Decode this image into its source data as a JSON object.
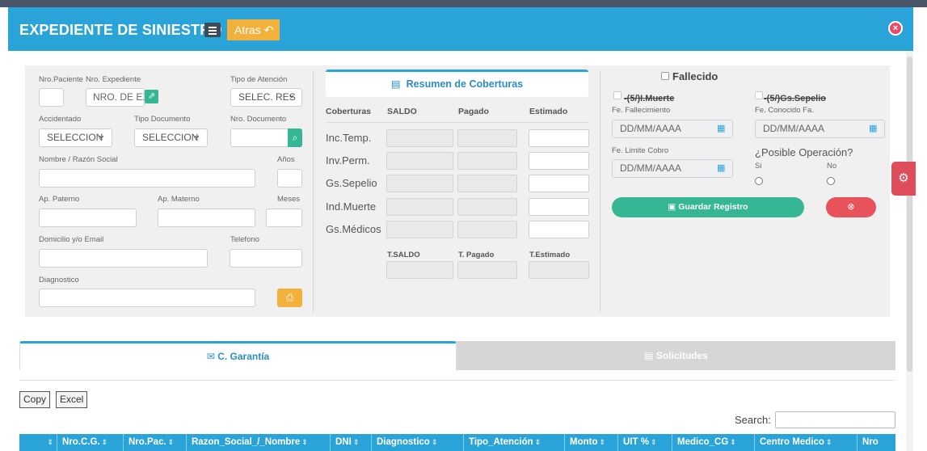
{
  "header": {
    "title": "EXPEDIENTE DE SINIESTRO",
    "back_label": "Atras",
    "back_icon": "↶",
    "close_icon": "⊗"
  },
  "form": {
    "nro_paciente_label": "Nro.Paciente",
    "nro_expediente_label": "Nro. Expediente",
    "nro_expediente_value": "NRO. DE EX",
    "tipo_atencion_label": "Tipo de Atención",
    "tipo_atencion_value": "SELEC. RES",
    "accidentado_label": "Accidentado",
    "accidentado_value": "SELECCION",
    "tipo_documento_label": "Tipo Documento",
    "tipo_documento_value": "SELECCION",
    "nro_documento_label": "Nro. Documento",
    "nombre_label": "Nombre / Razón Social",
    "anios_label": "Años",
    "ap_paterno_label": "Ap. Paterno",
    "ap_materno_label": "Ap. Materno",
    "meses_label": "Meses",
    "domicilio_label": "Domicilio y/o Email",
    "telefono_label": "Telefono",
    "diagnostico_label": "Diagnostico"
  },
  "coberturas": {
    "tab_label": "Resumen de Coberturas",
    "headers": [
      "Coberturas",
      "SALDO",
      "Pagado",
      "Estimado"
    ],
    "rows": [
      "Inc.Temp.",
      "Inv.Perm.",
      "Gs.Sepelio",
      "Ind.Muerte",
      "Gs.Médicos"
    ],
    "totals": [
      "T.SALDO",
      "T. Pagado",
      "T.Estimado"
    ]
  },
  "fallecido": {
    "label": "Fallecido",
    "muerte_label": "-(5/)I.Muerte",
    "sepelio_label": "-(5/)Gs.Sepelio",
    "fe_fallecimiento_label": "Fe. Fallecimiento",
    "fe_fallecimiento_placeholder": "DD/MM/AAAA",
    "fe_conocido_label": "Fe. Conocido Fa.",
    "fe_conocido_placeholder": "DD/MM/AAAA",
    "fe_limite_label": "Fe. Limite Cobro",
    "fe_limite_placeholder": "DD/MM/AAAA",
    "posible_operacion_label": "¿Posible Operación?",
    "si_label": "Si",
    "no_label": "No",
    "guardar_label": "Guardar Registro"
  },
  "tabs": {
    "garantia": "C. Garantía",
    "solicitudes": "Solicitudes"
  },
  "datatable": {
    "copy_label": "Copy",
    "excel_label": "Excel",
    "search_label": "Search:",
    "columns": [
      "",
      "Nro.C.G.",
      "Nro.Pac.",
      "Razon_Social_/_Nombre",
      "DNI",
      "Diagnostico",
      "Tipo_Atención",
      "Monto",
      "UIT %",
      "Medico_CG",
      "Centro Medico",
      "Nro"
    ]
  },
  "colors": {
    "primary": "#2aa3d9",
    "warning": "#f2b13b",
    "success": "#35b796",
    "danger": "#e8525a"
  }
}
